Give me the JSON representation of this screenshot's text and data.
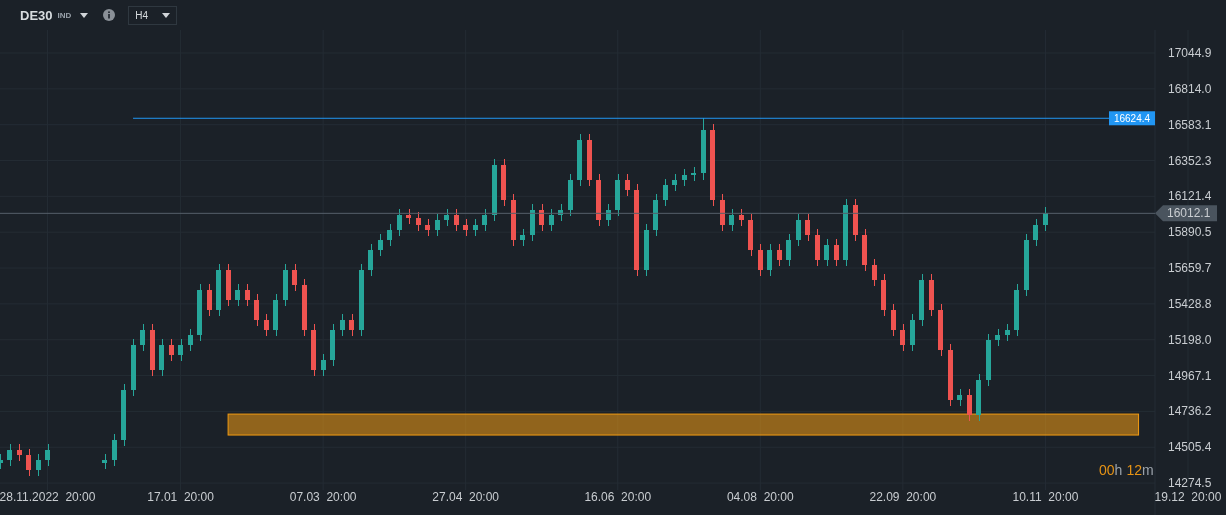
{
  "header": {
    "symbol": "DE30",
    "market": "IND",
    "timeframe": "H4"
  },
  "chart": {
    "chart_data": {
      "type": "candlestick",
      "categories": [
        null,
        null,
        null,
        null,
        null,
        "28.11.2022  20:00",
        null,
        null,
        null,
        null,
        null,
        null,
        null,
        null,
        null,
        null,
        null,
        null,
        null,
        "17.01  20:00",
        null,
        null,
        null,
        null,
        null,
        null,
        null,
        null,
        null,
        null,
        null,
        null,
        null,
        null,
        "07.03  20:00",
        null,
        null,
        null,
        null,
        null,
        null,
        null,
        null,
        null,
        null,
        null,
        null,
        null,
        null,
        "27.04  20:00",
        null,
        null,
        null,
        null,
        null,
        null,
        null,
        null,
        null,
        null,
        null,
        null,
        null,
        null,
        null,
        "16.06  20:00",
        null,
        null,
        null,
        null,
        null,
        null,
        null,
        null,
        null,
        null,
        null,
        null,
        null,
        null,
        "04.08  20:00",
        null,
        null,
        null,
        null,
        null,
        null,
        null,
        null,
        null,
        null,
        null,
        null,
        null,
        null,
        "22.09  20:00",
        null,
        null,
        null,
        null,
        null,
        null,
        null,
        null,
        null,
        null,
        null,
        null,
        null,
        null,
        "10.11  20:00",
        null,
        null,
        null,
        null,
        null,
        null,
        null,
        null,
        null,
        null,
        null,
        null,
        null,
        null,
        "19.12  20:00"
      ],
      "ohlc": [
        [
          14403,
          14463,
          14363,
          14423
        ],
        [
          14423,
          14527,
          14383,
          14487
        ],
        [
          14487,
          14527,
          14415,
          14455
        ],
        [
          14455,
          14495,
          14318,
          14358
        ],
        [
          14358,
          14463,
          14318,
          14423
        ],
        [
          14423,
          14527,
          14383,
          14487
        ],
        null,
        null,
        null,
        null,
        null,
        [
          14403,
          14463,
          14363,
          14423
        ],
        [
          14423,
          14592,
          14383,
          14552
        ],
        [
          14552,
          14914,
          14512,
          14874
        ],
        [
          14874,
          15203,
          14834,
          15163
        ],
        [
          15163,
          15300,
          15123,
          15260
        ],
        [
          15260,
          15300,
          14962,
          15002
        ],
        [
          15002,
          15203,
          14962,
          15163
        ],
        [
          15163,
          15203,
          15059,
          15099
        ],
        [
          15099,
          15203,
          15059,
          15163
        ],
        [
          15163,
          15268,
          15123,
          15228
        ],
        [
          15228,
          15558,
          15188,
          15518
        ],
        [
          15518,
          15558,
          15349,
          15389
        ],
        [
          15389,
          15687,
          15349,
          15647
        ],
        [
          15647,
          15687,
          15413,
          15453
        ],
        [
          15453,
          15558,
          15413,
          15518
        ],
        [
          15518,
          15558,
          15413,
          15453
        ],
        [
          15453,
          15493,
          15285,
          15325
        ],
        [
          15325,
          15365,
          15220,
          15260
        ],
        [
          15260,
          15493,
          15220,
          15453
        ],
        [
          15453,
          15687,
          15413,
          15647
        ],
        [
          15647,
          15687,
          15510,
          15550
        ],
        [
          15550,
          15590,
          15220,
          15260
        ],
        [
          15260,
          15300,
          14962,
          15002
        ],
        [
          15002,
          15107,
          14962,
          15067
        ],
        [
          15067,
          15300,
          15027,
          15260
        ],
        [
          15260,
          15365,
          15220,
          15325
        ],
        [
          15325,
          15365,
          15220,
          15260
        ],
        [
          15260,
          15687,
          15220,
          15647
        ],
        [
          15647,
          15815,
          15607,
          15775
        ],
        [
          15775,
          15880,
          15735,
          15840
        ],
        [
          15840,
          15945,
          15800,
          15905
        ],
        [
          15905,
          16041,
          15865,
          16001
        ],
        [
          16001,
          16041,
          15942,
          15982
        ],
        [
          15982,
          16022,
          15897,
          15937
        ],
        [
          15937,
          15977,
          15865,
          15905
        ],
        [
          15905,
          16009,
          15865,
          15969
        ],
        [
          15969,
          16041,
          15929,
          16001
        ],
        [
          16001,
          16041,
          15897,
          15937
        ],
        [
          15937,
          15977,
          15865,
          15905
        ],
        [
          15905,
          15977,
          15865,
          15937
        ],
        [
          15937,
          16041,
          15897,
          16001
        ],
        [
          16001,
          16363,
          15961,
          16323
        ],
        [
          16323,
          16363,
          16058,
          16098
        ],
        [
          16098,
          16138,
          15800,
          15840
        ],
        [
          15840,
          15913,
          15800,
          15873
        ],
        [
          15873,
          16074,
          15833,
          16034
        ],
        [
          16034,
          16074,
          15897,
          15937
        ],
        [
          15937,
          16041,
          15897,
          16001
        ],
        [
          16001,
          16074,
          15961,
          16034
        ],
        [
          16034,
          16267,
          15994,
          16227
        ],
        [
          16227,
          16524,
          16187,
          16484
        ],
        [
          16484,
          16524,
          16187,
          16227
        ],
        [
          16227,
          16267,
          15929,
          15969
        ],
        [
          15969,
          16074,
          15929,
          16034
        ],
        [
          16034,
          16267,
          15994,
          16227
        ],
        [
          16227,
          16267,
          16122,
          16162
        ],
        [
          16162,
          16202,
          15607,
          15647
        ],
        [
          15647,
          15945,
          15607,
          15905
        ],
        [
          15905,
          16138,
          15865,
          16098
        ],
        [
          16098,
          16235,
          16058,
          16195
        ],
        [
          16195,
          16267,
          16155,
          16227
        ],
        [
          16227,
          16299,
          16187,
          16259
        ],
        [
          16259,
          16310,
          16219,
          16270
        ],
        [
          16270,
          16624,
          16230,
          16549
        ],
        [
          16549,
          16589,
          16058,
          16098
        ],
        [
          16098,
          16138,
          15897,
          15937
        ],
        [
          15937,
          16041,
          15897,
          16001
        ],
        [
          16001,
          16041,
          15929,
          15969
        ],
        [
          15969,
          16009,
          15735,
          15775
        ],
        [
          15775,
          15815,
          15607,
          15647
        ],
        [
          15647,
          15815,
          15607,
          15775
        ],
        [
          15775,
          15815,
          15671,
          15711
        ],
        [
          15711,
          15880,
          15671,
          15840
        ],
        [
          15840,
          16009,
          15800,
          15969
        ],
        [
          15969,
          16009,
          15833,
          15873
        ],
        [
          15873,
          15913,
          15671,
          15711
        ],
        [
          15711,
          15848,
          15671,
          15808
        ],
        [
          15808,
          15848,
          15671,
          15711
        ],
        [
          15711,
          16106,
          15671,
          16066
        ],
        [
          16066,
          16106,
          15833,
          15873
        ],
        [
          15873,
          15913,
          15639,
          15679
        ],
        [
          15679,
          15719,
          15542,
          15582
        ],
        [
          15582,
          15622,
          15349,
          15389
        ],
        [
          15389,
          15429,
          15220,
          15260
        ],
        [
          15260,
          15300,
          15123,
          15163
        ],
        [
          15163,
          15365,
          15123,
          15325
        ],
        [
          15325,
          15622,
          15285,
          15582
        ],
        [
          15582,
          15622,
          15349,
          15389
        ],
        [
          15389,
          15429,
          15091,
          15131
        ],
        [
          15131,
          15171,
          14769,
          14809
        ],
        [
          14809,
          14881,
          14769,
          14841
        ],
        [
          14841,
          14881,
          14672,
          14712
        ],
        [
          14712,
          14978,
          14672,
          14938
        ],
        [
          14938,
          15236,
          14898,
          15196
        ],
        [
          15196,
          15268,
          15156,
          15228
        ],
        [
          15228,
          15300,
          15188,
          15260
        ],
        [
          15260,
          15558,
          15220,
          15518
        ],
        [
          15518,
          15880,
          15478,
          15840
        ],
        [
          15840,
          15977,
          15800,
          15937
        ],
        [
          15937,
          16052,
          15897,
          16012
        ],
        null,
        null,
        null,
        null,
        null,
        null,
        null,
        null,
        null,
        null,
        null,
        null,
        null,
        null,
        null
      ],
      "ylim": [
        14230,
        17193
      ],
      "grid": true,
      "yticks": [
        {
          "value": 17044.9,
          "label": "17044.9"
        },
        {
          "value": 16814.0,
          "label": "16814.0"
        },
        {
          "value": 16583.1,
          "label": "16583.1"
        },
        {
          "value": 16352.3,
          "label": "16352.3"
        },
        {
          "value": 16121.4,
          "label": "16121.4"
        },
        {
          "value": 15890.5,
          "label": "15890.5"
        },
        {
          "value": 15659.7,
          "label": "15659.7"
        },
        {
          "value": 15428.8,
          "label": "15428.8"
        },
        {
          "value": 15198.0,
          "label": "15198.0"
        },
        {
          "value": 14967.1,
          "label": "14967.1"
        },
        {
          "value": 14736.2,
          "label": "14736.2"
        },
        {
          "value": 14505.4,
          "label": "14505.4"
        },
        {
          "value": 14274.5,
          "label": "14274.5"
        }
      ],
      "ref_lines": [
        {
          "axis": "y",
          "value": 16624.4,
          "label": "16624.4",
          "color": "#2196f3"
        },
        {
          "axis": "y",
          "value": 16012.1,
          "label": "16012.1",
          "color": "#56606a"
        }
      ],
      "bands": [
        {
          "axis": "y",
          "from": 14584,
          "to": 14719,
          "color": "#f39c12"
        }
      ]
    }
  },
  "countdown": [
    {
      "kind": "number",
      "text": "00"
    },
    {
      "kind": "unit",
      "text": "h"
    },
    {
      "kind": "number",
      "text": "12"
    },
    {
      "kind": "unit",
      "text": "m"
    }
  ]
}
